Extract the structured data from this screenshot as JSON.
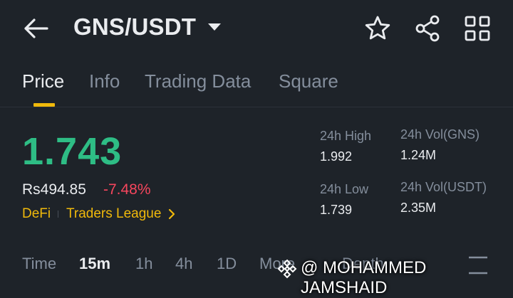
{
  "header": {
    "pair": "GNS/USDT",
    "icons": [
      "back-arrow-icon",
      "caret-down-icon",
      "star-icon",
      "share-icon",
      "grid-icon"
    ]
  },
  "tabs": [
    {
      "label": "Price",
      "active": true
    },
    {
      "label": "Info",
      "active": false
    },
    {
      "label": "Trading Data",
      "active": false
    },
    {
      "label": "Square",
      "active": false
    }
  ],
  "price": {
    "last": "1.743",
    "fiat": "Rs494.85",
    "change": "-7.48%",
    "tags": [
      "DeFi",
      "Traders League"
    ]
  },
  "stats": {
    "high_label": "24h High",
    "high_value": "1.992",
    "low_label": "24h Low",
    "low_value": "1.739",
    "vol_base_label": "24h Vol(GNS)",
    "vol_base_value": "1.24M",
    "vol_quote_label": "24h Vol(USDT)",
    "vol_quote_value": "2.35M"
  },
  "intervals": {
    "time": "Time",
    "items": [
      "15m",
      "1h",
      "4h",
      "1D"
    ],
    "more": "More",
    "depth": "Depth",
    "selected": "15m"
  },
  "watermark": {
    "text": "@ MOHAMMED JAMSHAID"
  },
  "colors": {
    "background": "#1e2329",
    "up": "#2ebd85",
    "down": "#f6465d",
    "accent": "#f0b90b",
    "muted": "#848e9c"
  }
}
